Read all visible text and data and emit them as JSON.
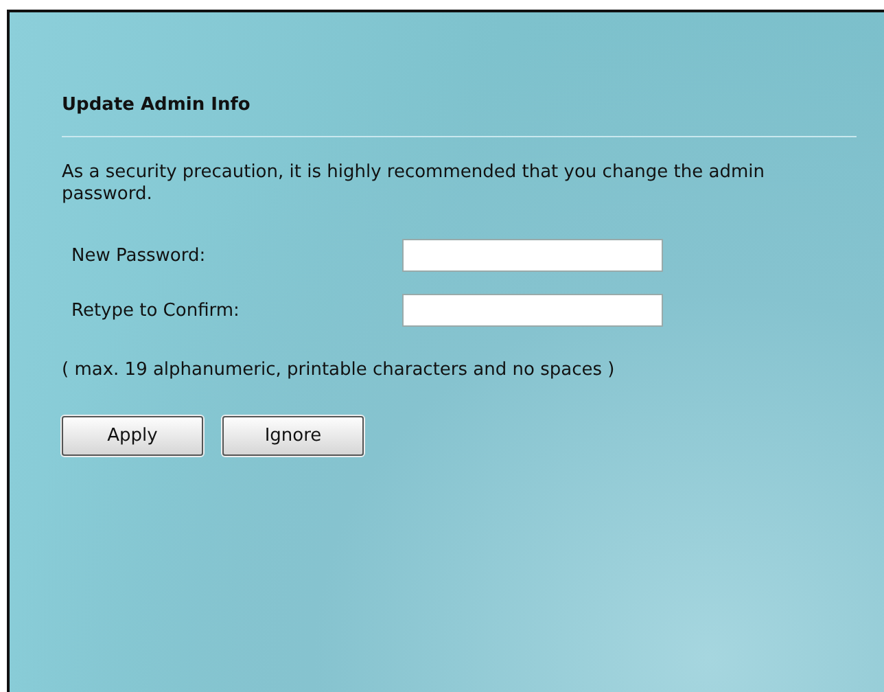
{
  "panel": {
    "title": "Update Admin Info",
    "message": "As a security precaution, it is highly recommended that you change the admin password."
  },
  "fields": [
    {
      "label": "New Password:"
    },
    {
      "label": "Retype to Confirm:"
    }
  ],
  "note": "( max. 19 alphanumeric, printable characters and no spaces )",
  "buttons": [
    "Apply",
    "Ignore"
  ]
}
